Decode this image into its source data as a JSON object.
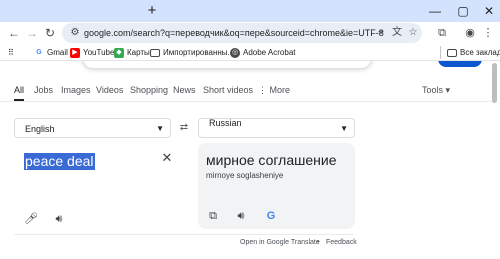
{
  "browser": {
    "new_tab_glyph": "+",
    "url": "google.com/search?q=переводчик&oq=пере&sourceid=chrome&ie=UTF-8",
    "window_controls": {
      "minimize": "—",
      "maximize": "▢",
      "close": "✕"
    }
  },
  "bookmarks": {
    "items": [
      {
        "label": "Gmail",
        "icon": "google-icon"
      },
      {
        "label": "YouTube",
        "icon": "youtube-icon"
      },
      {
        "label": "Карты",
        "icon": "maps-icon"
      },
      {
        "label": "Импортированны...",
        "icon": "folder-icon"
      },
      {
        "label": "Adobe Acrobat",
        "icon": "acrobat-icon"
      }
    ],
    "all_bookmarks_label": "Все закладки"
  },
  "search": {
    "tabs": [
      "All",
      "Jobs",
      "Images",
      "Videos",
      "Shopping",
      "News",
      "Short videos",
      "⋮ More"
    ],
    "active_tab": "All",
    "tools_label": "Tools"
  },
  "translator": {
    "source_lang": "English",
    "target_lang": "Russian",
    "source_text": "peace deal",
    "translation": "мирное соглашение",
    "transliteration": "mirnoye soglasheniye",
    "clear_glyph": "✕",
    "footer": {
      "open_label": "Open in Google Translate",
      "separator": "•",
      "feedback_label": "Feedback"
    }
  },
  "colors": {
    "selection": "#3a6ad6",
    "tabstrip": "#d3e3fd",
    "accent_button": "#0b57d0"
  }
}
